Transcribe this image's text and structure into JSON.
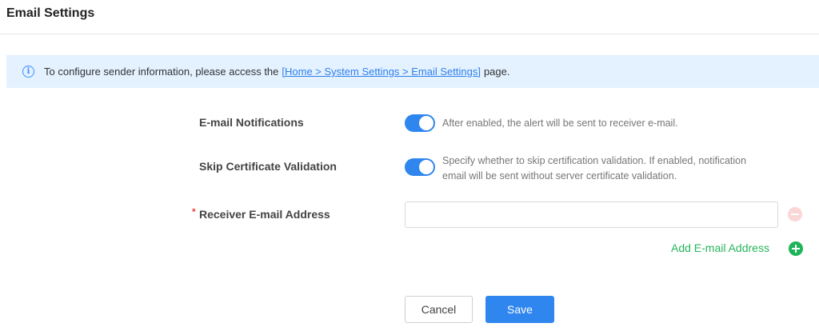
{
  "header": {
    "title": "Email Settings"
  },
  "banner": {
    "text_before": "To configure sender information, please access the",
    "link_text": "[Home > System Settings > Email Settings]",
    "text_after": "page."
  },
  "form": {
    "email_notifications": {
      "label": "E-mail Notifications",
      "enabled": true,
      "help": "After enabled, the alert will be sent to receiver e-mail."
    },
    "skip_cert": {
      "label": "Skip Certificate Validation",
      "enabled": true,
      "help_line1": "Specify whether to skip certification validation. If enabled, notification",
      "help_line2": "email will be sent without server certificate validation."
    },
    "receiver": {
      "required_mark": "*",
      "label": "Receiver E-mail Address",
      "value": ""
    },
    "add_address_label": "Add E-mail Address"
  },
  "actions": {
    "cancel_label": "Cancel",
    "save_label": "Save"
  },
  "colors": {
    "primary": "#2f86ee",
    "success": "#1fb45a",
    "danger_light": "#fbd6d6",
    "banner_bg": "#e4f1ff"
  }
}
